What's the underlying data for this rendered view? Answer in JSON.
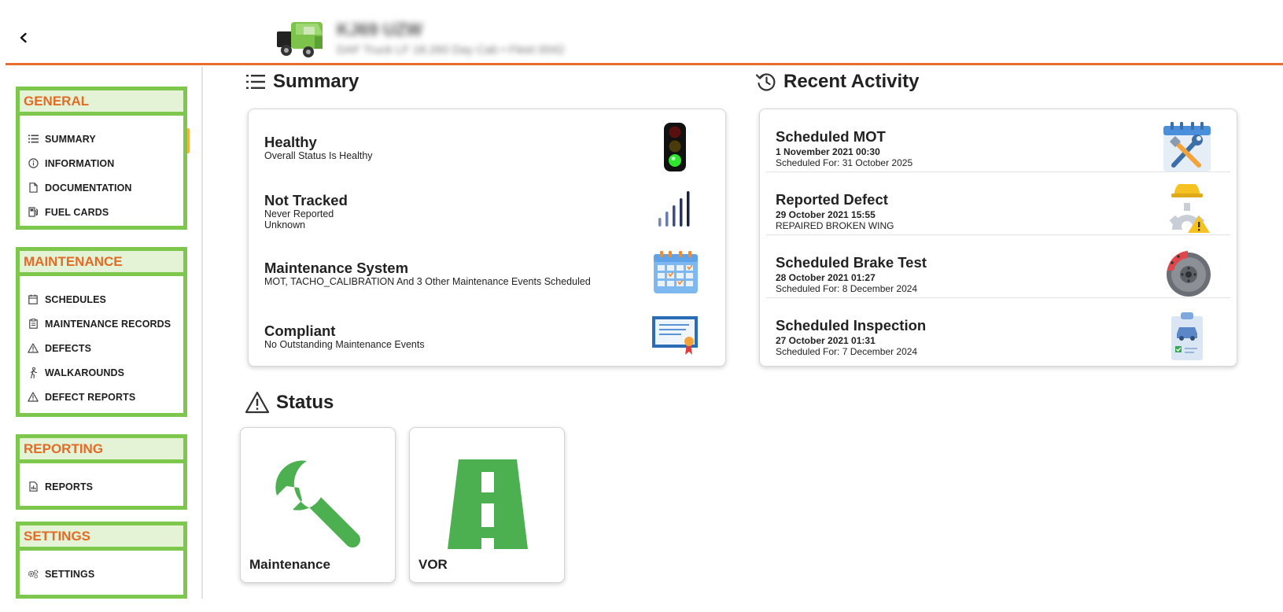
{
  "header": {
    "back_icon": "chevron-left-icon",
    "vehicle_title": "KJ69 UZW",
    "vehicle_subtitle": "DAF Truck LF 18.260 Day Cab • Fleet 0042"
  },
  "colors": {
    "accent_orange": "#ea6b2c",
    "nav_green": "#7cc74c",
    "status_green": "#4caf50"
  },
  "sidebar": {
    "sections": [
      {
        "title": "GENERAL",
        "items": [
          {
            "label": "SUMMARY",
            "icon": "list-icon"
          },
          {
            "label": "INFORMATION",
            "icon": "info-circle-icon"
          },
          {
            "label": "DOCUMENTATION",
            "icon": "document-icon"
          },
          {
            "label": "FUEL CARDS",
            "icon": "fuel-pump-icon"
          }
        ]
      },
      {
        "title": "MAINTENANCE",
        "items": [
          {
            "label": "SCHEDULES",
            "icon": "calendar-icon"
          },
          {
            "label": "MAINTENANCE RECORDS",
            "icon": "clipboard-icon"
          },
          {
            "label": "DEFECTS",
            "icon": "warning-triangle-icon"
          },
          {
            "label": "WALKAROUNDS",
            "icon": "walking-person-icon"
          },
          {
            "label": "DEFECT REPORTS",
            "icon": "warning-triangle-icon"
          }
        ]
      },
      {
        "title": "REPORTING",
        "items": [
          {
            "label": "REPORTS",
            "icon": "report-file-icon"
          }
        ]
      },
      {
        "title": "SETTINGS",
        "items": [
          {
            "label": "SETTINGS",
            "icon": "gears-icon"
          }
        ]
      }
    ]
  },
  "summary": {
    "heading": "Summary",
    "rows": [
      {
        "title": "Healthy",
        "subtitle": "Overall Status Is Healthy",
        "subtitle2": "",
        "icon": "traffic-light-icon"
      },
      {
        "title": "Not Tracked",
        "subtitle": "Never Reported",
        "subtitle2": "Unknown",
        "icon": "signal-bars-icon"
      },
      {
        "title": "Maintenance System",
        "subtitle": "MOT, TACHO_CALIBRATION And 3 Other Maintenance Events Scheduled",
        "subtitle2": "",
        "icon": "calendar-checks-icon"
      },
      {
        "title": "Compliant",
        "subtitle": "No Outstanding Maintenance Events",
        "subtitle2": "",
        "icon": "certificate-icon"
      }
    ]
  },
  "activity": {
    "heading": "Recent Activity",
    "rows": [
      {
        "title": "Scheduled MOT",
        "date": "1 November 2021 00:30",
        "detail": "Scheduled For: 31 October 2025",
        "icon": "calendar-tools-icon"
      },
      {
        "title": "Reported Defect",
        "date": "29 October 2021 15:55",
        "detail": "REPAIRED BROKEN WING",
        "icon": "gear-warning-icon"
      },
      {
        "title": "Scheduled Brake Test",
        "date": "28 October 2021 01:27",
        "detail": "Scheduled For: 8 December 2024",
        "icon": "brake-disc-icon"
      },
      {
        "title": "Scheduled Inspection",
        "date": "27 October 2021 01:31",
        "detail": "Scheduled For: 7 December 2024",
        "icon": "inspection-clipboard-icon"
      }
    ]
  },
  "status": {
    "heading": "Status",
    "tiles": [
      {
        "label": "Maintenance",
        "icon": "wrench-icon"
      },
      {
        "label": "VOR",
        "icon": "road-icon"
      }
    ]
  }
}
